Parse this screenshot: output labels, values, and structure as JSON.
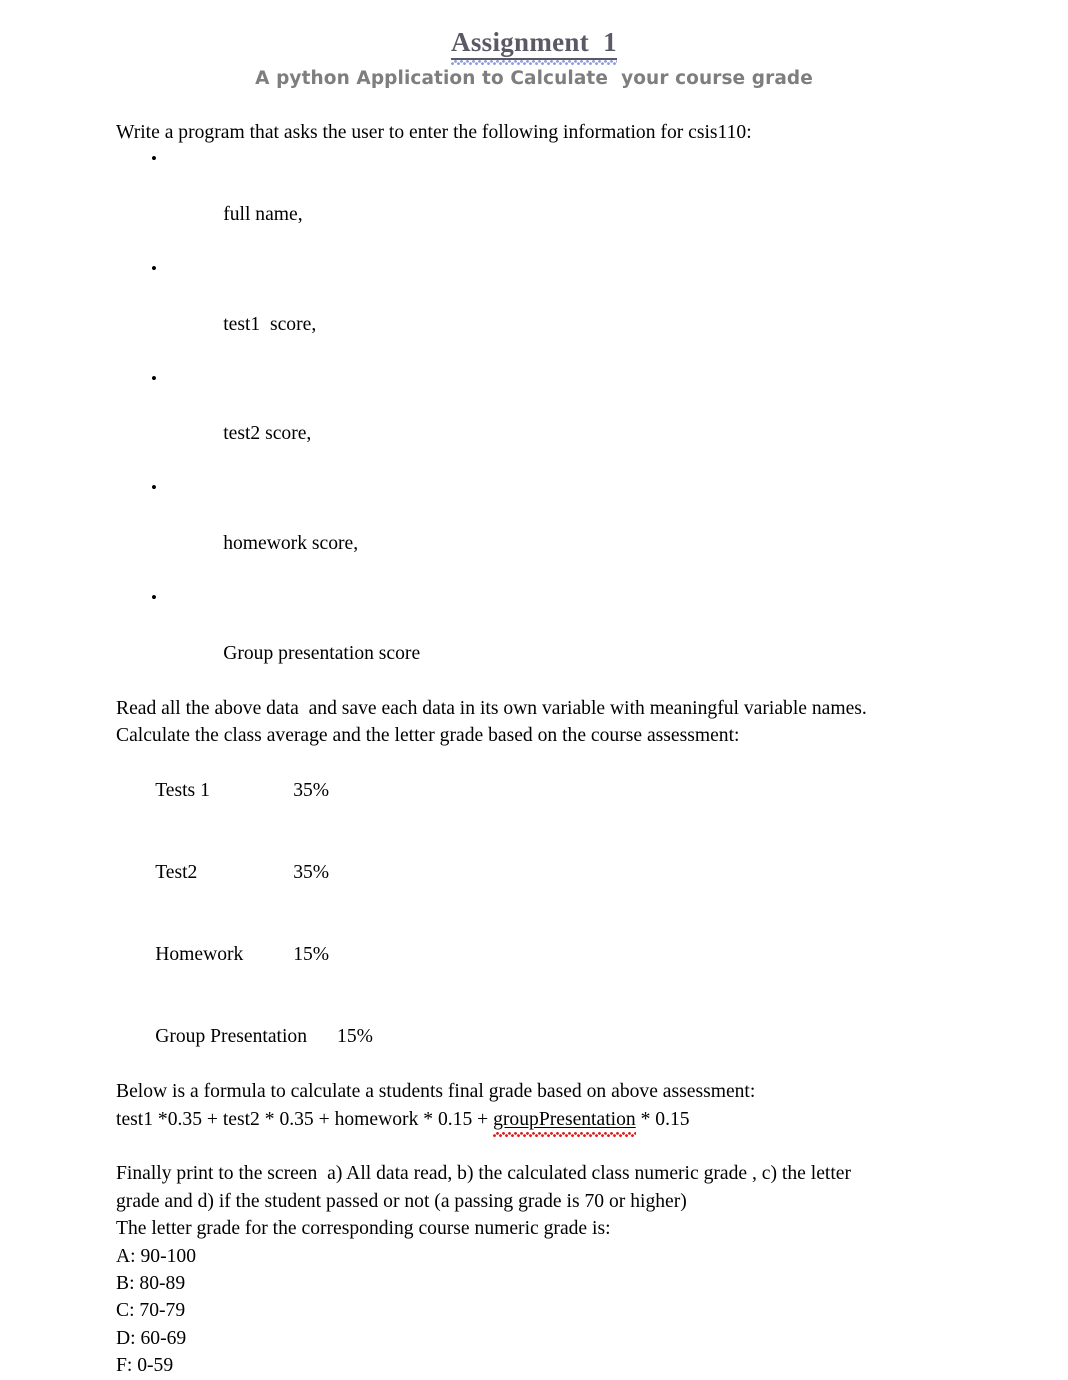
{
  "document": {
    "title": "Assignment  1",
    "subtitle": "A python Application to Calculate  your course grade",
    "title_color": "#5a5a66",
    "subtitle_color": "#7e7e7e",
    "grammar_underline_color": "#8f9ede",
    "spelling_underline_color": "#e02020"
  },
  "body": {
    "intro": "Write a program that asks the user to enter the following information for csis110:",
    "bullet_glyph": "•",
    "inputs": [
      "full name,",
      "test1  score,",
      "test2 score,",
      "homework score,",
      "Group presentation score"
    ],
    "read_instruction": "Read all the above data  and save each data in its own variable with meaningful variable names.",
    "calculate_instruction": "Calculate the class average and the letter grade based on the course assessment:",
    "assessment": [
      {
        "name": "Tests 1",
        "weight": "35%"
      },
      {
        "name": "Test2",
        "weight": "35%"
      },
      {
        "name": "Homework",
        "weight": "15%"
      },
      {
        "name": "Group Presentation",
        "weight": "15%"
      }
    ],
    "formula_intro": "Below is a formula to calculate a students final grade based on above assessment:",
    "formula": {
      "prefix": "test1 *0.35 + test2 * 0.35 + homework * 0.15 + ",
      "misspelled_word": "groupPresentation",
      "suffix": " * 0.15"
    },
    "print_instruction_line1": "Finally print to the screen  a) All data read, b) the calculated class numeric grade , c) the letter",
    "print_instruction_line2": "grade and d) if the student passed or not (a passing grade is 70 or higher)",
    "letter_grade_intro": "The letter grade for the corresponding course numeric grade is:",
    "letter_grades": [
      "A: 90-100",
      "B: 80-89",
      "C: 70-79",
      "D: 60-69",
      "F: 0-59"
    ]
  }
}
